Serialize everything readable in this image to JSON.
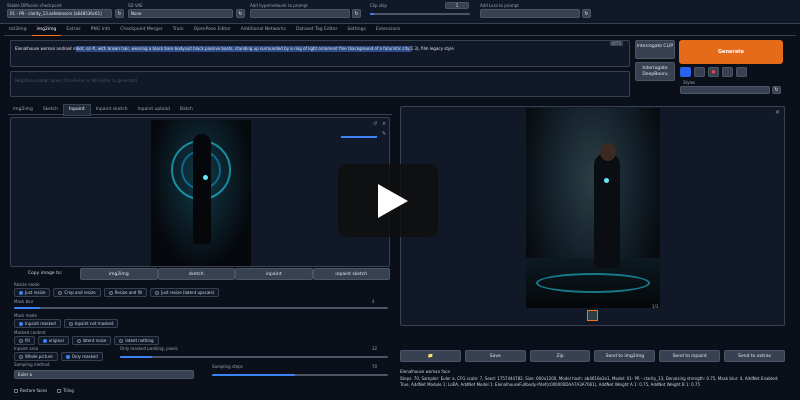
{
  "top": {
    "checkpoint_label": "Stable Diffusion checkpoint",
    "checkpoint_value": "01 - PR - clarity_13.safetensors [a648536c61]",
    "vae_label": "SD VAE",
    "vae_value": "None",
    "hypernet_label": "Add hypernetwork to prompt",
    "clipskip_label": "Clip skip",
    "clipskip_value": "1",
    "lora_label": "Add Lora to prompt"
  },
  "main_tabs": [
    "txt2img",
    "img2img",
    "Extras",
    "PNG Info",
    "Checkpoint Merger",
    "Train",
    "OpenPose Editor",
    "Additional Networks",
    "Dataset Tag Editor",
    "Settings",
    "Extensions"
  ],
  "prompt": {
    "text": "Elenalhouse woman android robot, sci-fi, with brown hair, wearing a black bare bodysuit black passive boots, standing up surrounded by a ring of light ornament fine (background of a futuristic city:1.3), film legacy style",
    "counter": "0/75",
    "negative_placeholder": "Negative prompt (press Ctrl+Enter or Alt+Enter to generate)"
  },
  "side_buttons": {
    "clip": "Interrogate CLIP",
    "deepbooru": "Interrogate DeepBooru",
    "generate": "Generate",
    "styles_label": "Styles"
  },
  "sub_tabs": [
    "img2img",
    "Sketch",
    "Inpaint",
    "Inpaint sketch",
    "Inpaint upload",
    "Batch"
  ],
  "copy": {
    "label": "Copy image to:",
    "buttons": [
      "img2img",
      "sketch",
      "inpaint",
      "inpaint sketch"
    ]
  },
  "resize": {
    "label": "Resize mode",
    "options": [
      "Just resize",
      "Crop and resize",
      "Resize and fill",
      "Just resize (latent upscale)"
    ],
    "selected": 0
  },
  "mask_blur": {
    "label": "Mask blur",
    "value": "4",
    "fraction": 0.07
  },
  "mask_mode": {
    "label": "Mask mode",
    "options": [
      "Inpaint masked",
      "Inpaint not masked"
    ],
    "selected": 0
  },
  "masked_content": {
    "label": "Masked content",
    "options": [
      "fill",
      "original",
      "latent noise",
      "latent nothing"
    ],
    "selected": 1
  },
  "inpaint_area": {
    "label": "Inpaint area",
    "options": [
      "Whole picture",
      "Only masked"
    ],
    "selected": 1
  },
  "padding": {
    "label": "Only masked padding, pixels",
    "value": "32",
    "fraction": 0.12
  },
  "sampling": {
    "method_label": "Sampling method",
    "method_value": "Euler a",
    "steps_label": "Sampling steps",
    "steps_value": "70",
    "steps_fraction": 0.47
  },
  "checkboxes": [
    "Restore faces",
    "Tiling"
  ],
  "output": {
    "buttons": [
      "📁",
      "Save",
      "Zip",
      "Send to img2img",
      "Send to inpaint",
      "Send to extras"
    ],
    "info_title": "Elenalhouse woman face",
    "info_text": "Steps: 70, Sampler: Euler a, CFG scale: 7, Seed: 1757444782, Size: 600x1200, Model hash: ab4616e2e1, Model: 01- PR - clarity_13, Denoising strength: 0.75, Mask blur: 4, AddNet Enabled: True, AddNet Module 1: LoRA, AddNet Model 1: ElenalhouseFullbody-lfdef(c000000DAA7A3A7661), AddNet Weight A 1: 0.75, AddNet Weight B 1: 0.75",
    "image_caption": "1/3"
  },
  "colors": {
    "accent": "#f97316",
    "primary": "#3b82f6",
    "bg": "#0b0f19"
  },
  "overlay": {
    "icon": "play-icon"
  }
}
